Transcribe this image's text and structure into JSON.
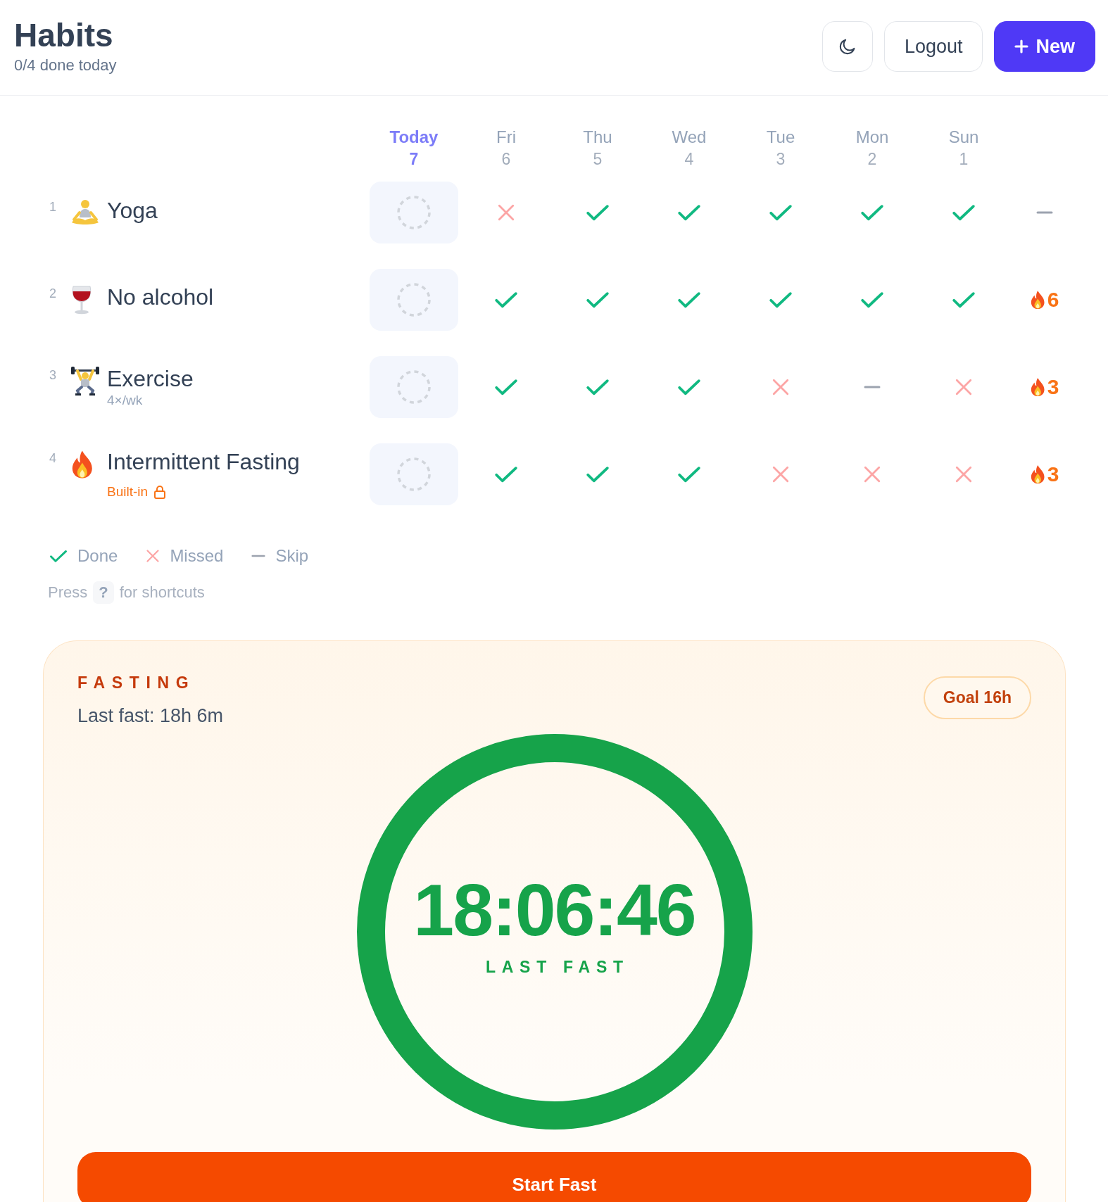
{
  "header": {
    "title": "Habits",
    "subtitle": "0/4 done today",
    "buttons": [
      {
        "kind": "theme"
      },
      {
        "kind": "secondary",
        "label": "Logout"
      },
      {
        "kind": "primary",
        "label": "New"
      }
    ]
  },
  "columns": [
    {
      "name": "Today",
      "date": "7",
      "selected": true
    },
    {
      "name": "Fri",
      "date": "6",
      "selected": false
    },
    {
      "name": "Thu",
      "date": "5",
      "selected": false
    },
    {
      "name": "Wed",
      "date": "4",
      "selected": false
    },
    {
      "name": "Tue",
      "date": "3",
      "selected": false
    },
    {
      "name": "Mon",
      "date": "2",
      "selected": false
    },
    {
      "name": "Sun",
      "date": "1",
      "selected": false
    }
  ],
  "habits": [
    {
      "number": "1",
      "kind": "meditation",
      "name": "Yoga",
      "today_done": false,
      "days": [
        {
          "kind": "missed"
        },
        {
          "kind": "done"
        },
        {
          "kind": "done"
        },
        {
          "kind": "done"
        },
        {
          "kind": "done"
        },
        {
          "kind": "done"
        }
      ],
      "streak": {
        "kind": "none"
      }
    },
    {
      "number": "2",
      "kind": "wine",
      "name": "No alcohol",
      "today_done": false,
      "days": [
        {
          "kind": "done"
        },
        {
          "kind": "done"
        },
        {
          "kind": "done"
        },
        {
          "kind": "done"
        },
        {
          "kind": "done"
        },
        {
          "kind": "done"
        }
      ],
      "streak": {
        "kind": "fire",
        "count": "6"
      }
    },
    {
      "number": "3",
      "kind": "lifter",
      "name": "Exercise",
      "subtitle": "4×/wk",
      "today_done": false,
      "days": [
        {
          "kind": "done"
        },
        {
          "kind": "done"
        },
        {
          "kind": "done"
        },
        {
          "kind": "missed"
        },
        {
          "kind": "skip"
        },
        {
          "kind": "missed"
        }
      ],
      "streak": {
        "kind": "fire",
        "count": "3"
      }
    },
    {
      "number": "4",
      "kind": "fire",
      "name": "Intermittent Fasting",
      "badge": "Built-in",
      "locked": true,
      "today_done": false,
      "days": [
        {
          "kind": "done"
        },
        {
          "kind": "done"
        },
        {
          "kind": "done"
        },
        {
          "kind": "missed"
        },
        {
          "kind": "missed"
        },
        {
          "kind": "missed"
        }
      ],
      "streak": {
        "kind": "fire",
        "count": "3"
      }
    }
  ],
  "legend": [
    {
      "kind": "done",
      "label": "Done"
    },
    {
      "kind": "missed",
      "label": "Missed"
    },
    {
      "kind": "skip",
      "label": "Skip"
    }
  ],
  "hint": {
    "before": "Press",
    "key": "?",
    "after": "for shortcuts"
  },
  "fasting": {
    "title": "FASTING",
    "last": "Last fast: 18h 6m",
    "goal": "Goal 16h",
    "level": 1,
    "time": "18:06:46",
    "caption": "LAST FAST",
    "button": "Start Fast"
  }
}
